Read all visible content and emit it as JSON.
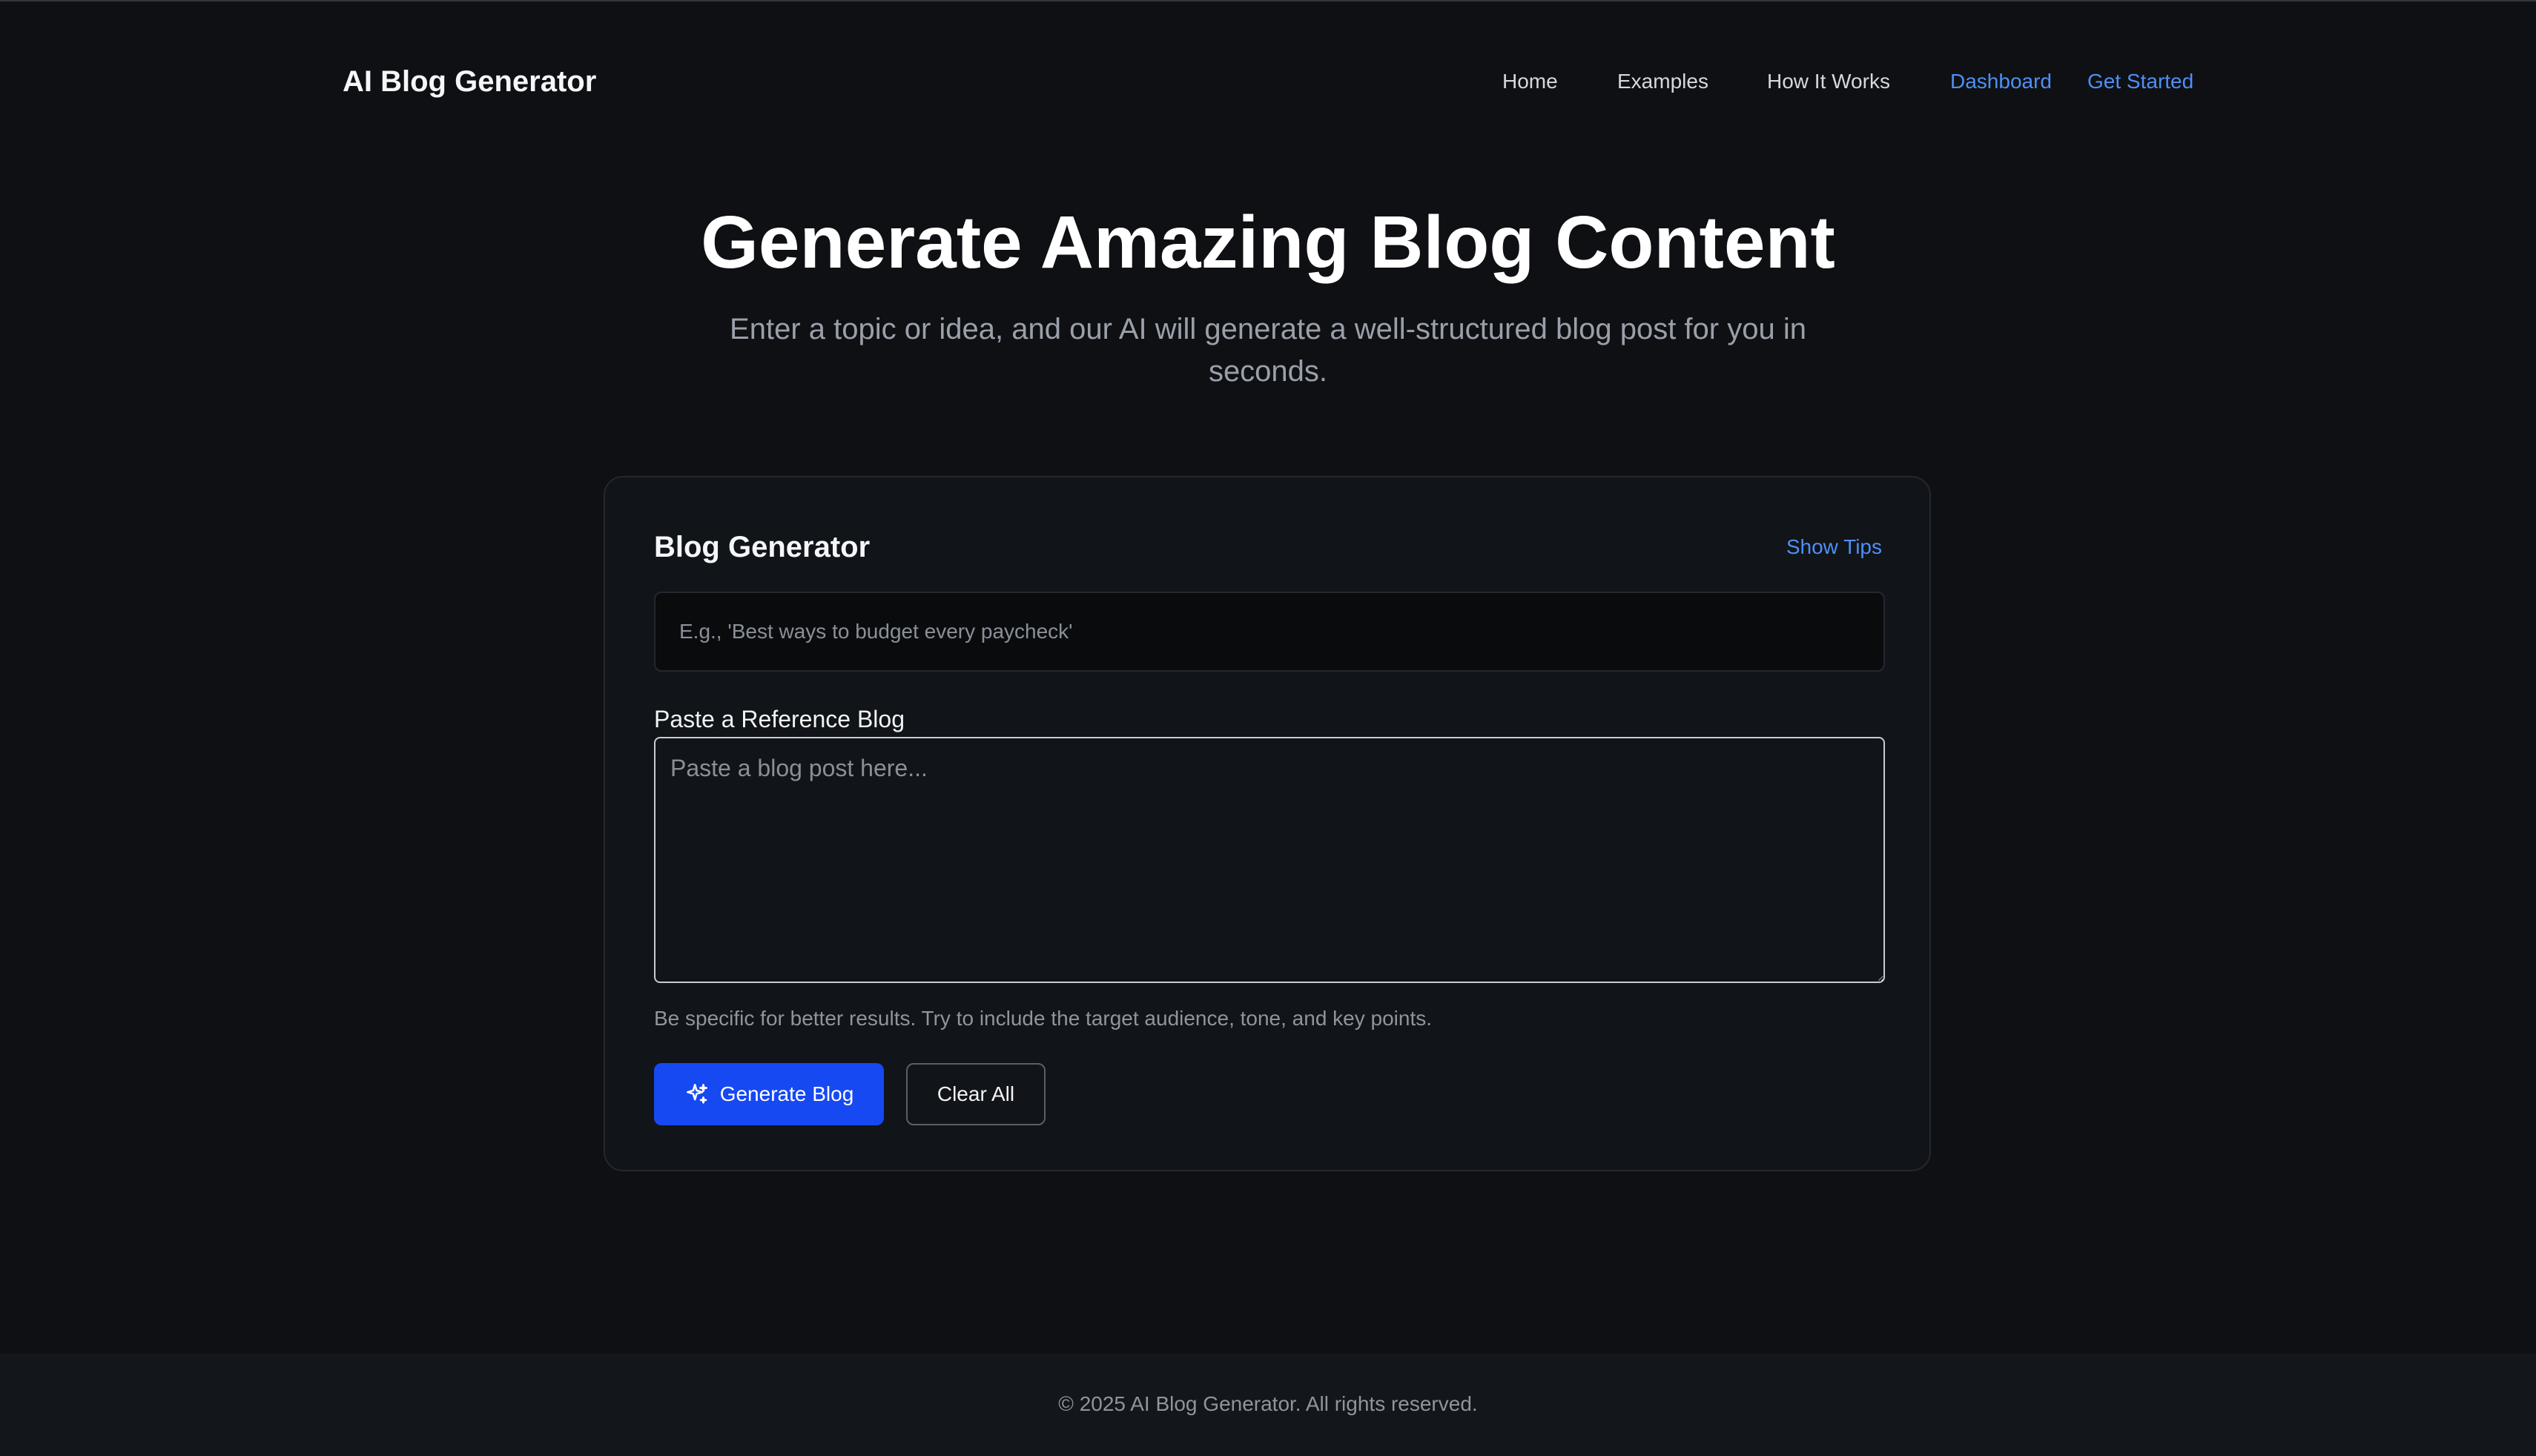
{
  "header": {
    "brand": "AI Blog Generator",
    "nav": {
      "home": "Home",
      "examples": "Examples",
      "how_it_works": "How It Works",
      "dashboard": "Dashboard",
      "get_started": "Get Started"
    }
  },
  "hero": {
    "title": "Generate Amazing Blog Content",
    "subtitle": "Enter a topic or idea, and our AI will generate a well-structured blog post for you in seconds."
  },
  "generator": {
    "title": "Blog Generator",
    "show_tips": "Show Tips",
    "topic_placeholder": "E.g., 'Best ways to budget every paycheck'",
    "topic_value": "",
    "reference_label": "Paste a Reference Blog",
    "reference_placeholder": "Paste a blog post here...",
    "reference_value": "",
    "hint": "Be specific for better results. Try to include the target audience, tone, and key points.",
    "generate_label": "Generate Blog",
    "generate_icon": "sparkles-icon",
    "clear_label": "Clear All"
  },
  "footer": {
    "copyright": "© 2025 AI Blog Generator. All rights reserved."
  },
  "colors": {
    "background": "#0e1013",
    "card": "#111418",
    "accent_link": "#4f8ff7",
    "primary_button": "#1649f2"
  }
}
